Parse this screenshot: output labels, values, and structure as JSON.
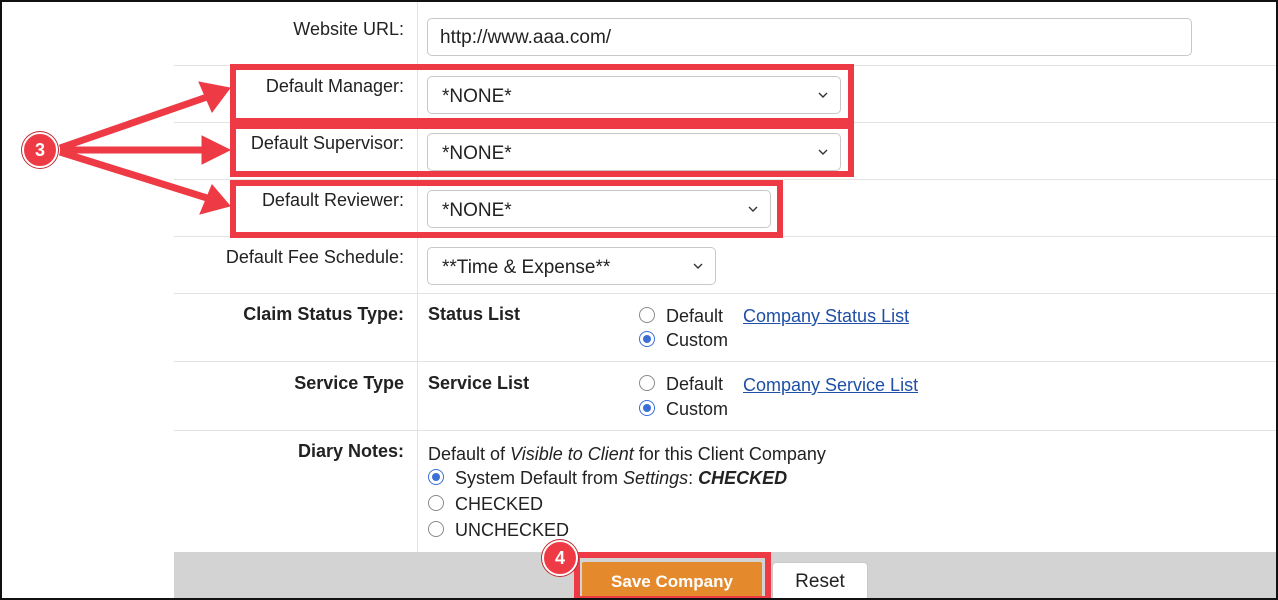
{
  "form": {
    "website_url": {
      "label": "Website URL:",
      "value": "http://www.aaa.com/"
    },
    "default_manager": {
      "label": "Default Manager:",
      "value": "*NONE*"
    },
    "default_supervisor": {
      "label": "Default Supervisor:",
      "value": "*NONE*"
    },
    "default_reviewer": {
      "label": "Default Reviewer:",
      "value": "*NONE*"
    },
    "default_fee_schedule": {
      "label": "Default Fee Schedule:",
      "value": "**Time & Expense**"
    },
    "claim_status_type": {
      "label": "Claim Status Type:",
      "list_title": "Status List",
      "option_default": "Default",
      "option_custom": "Custom",
      "selected": "Custom",
      "link": "Company Status List"
    },
    "service_type": {
      "label": "Service Type",
      "list_title": "Service List",
      "option_default": "Default",
      "option_custom": "Custom",
      "selected": "Custom",
      "link": "Company Service List"
    },
    "diary_notes": {
      "label": "Diary Notes:",
      "desc_prefix": "Default of ",
      "desc_italic": "Visible to Client",
      "desc_suffix": " for this Client Company",
      "opt1_prefix": "System Default from ",
      "opt1_italic": "Settings",
      "opt1_colon": ": ",
      "opt1_value": "CHECKED",
      "opt2": "CHECKED",
      "opt3": "UNCHECKED",
      "selected": "system-default"
    }
  },
  "actions": {
    "save_label": "Save Company",
    "reset_label": "Reset"
  },
  "annotations": {
    "badge_3": "3",
    "badge_4": "4",
    "highlight_color": "#ee3a44"
  },
  "colors": {
    "save_button": "#e5892d",
    "footer_bar": "#d3d3d3",
    "link": "#1f4fa6",
    "radio_selected": "#3b6fd6"
  },
  "icons": {
    "select_arrow": "chevron-down-icon"
  }
}
